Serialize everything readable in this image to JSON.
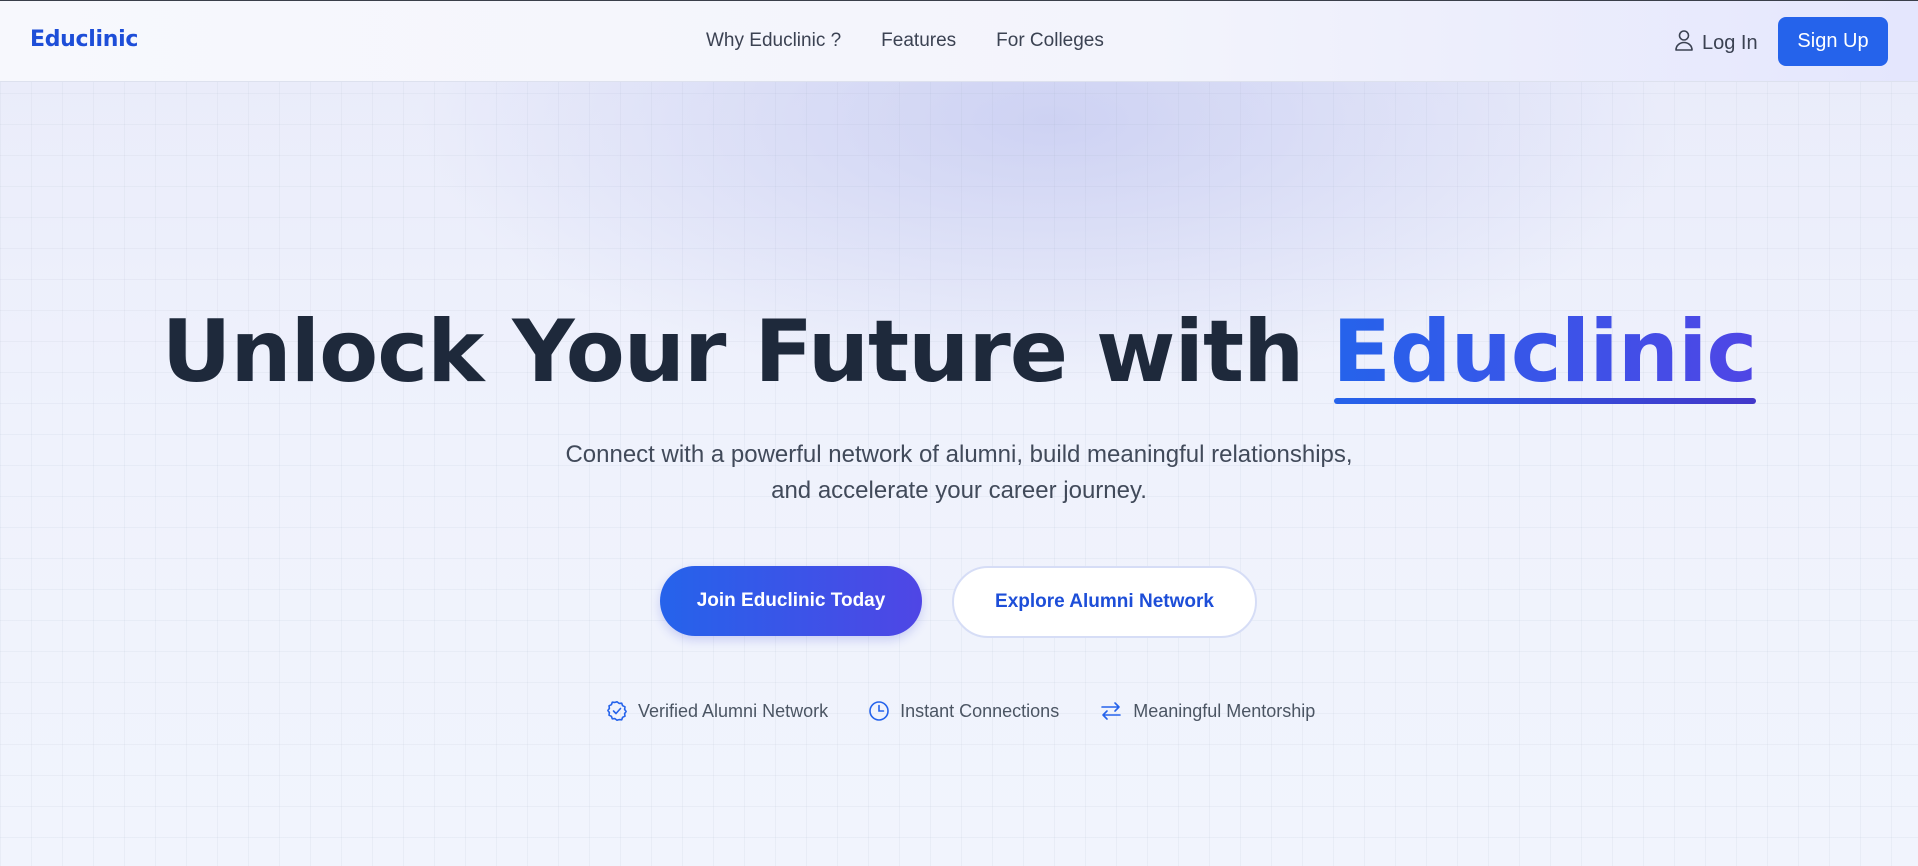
{
  "nav": {
    "logo": "Educlinic",
    "links": [
      "Why Educlinic ?",
      "Features",
      "For Colleges"
    ],
    "login_label": "Log In",
    "login_icon": "user-icon",
    "signup_label": "Sign Up"
  },
  "hero": {
    "headline_prefix": "Unlock Your Future with ",
    "headline_brand": "Educlinic",
    "subtitle_line1": "Connect with a powerful network of alumni, build meaningful relationships,",
    "subtitle_line2": "and accelerate your career journey.",
    "primary_button": "Join Educlinic Today",
    "secondary_button": "Explore Alumni Network"
  },
  "features": [
    {
      "label": "Verified Alumni Network",
      "icon": "check-circle-icon"
    },
    {
      "label": "Instant Connections",
      "icon": "clock-icon"
    },
    {
      "label": "Meaningful Mentorship",
      "icon": "arrows-exchange-icon"
    }
  ],
  "colors": {
    "accent": "#2563eb",
    "accent_end": "#4f46e5",
    "heading": "#1e293b",
    "text": "#414a5a"
  }
}
